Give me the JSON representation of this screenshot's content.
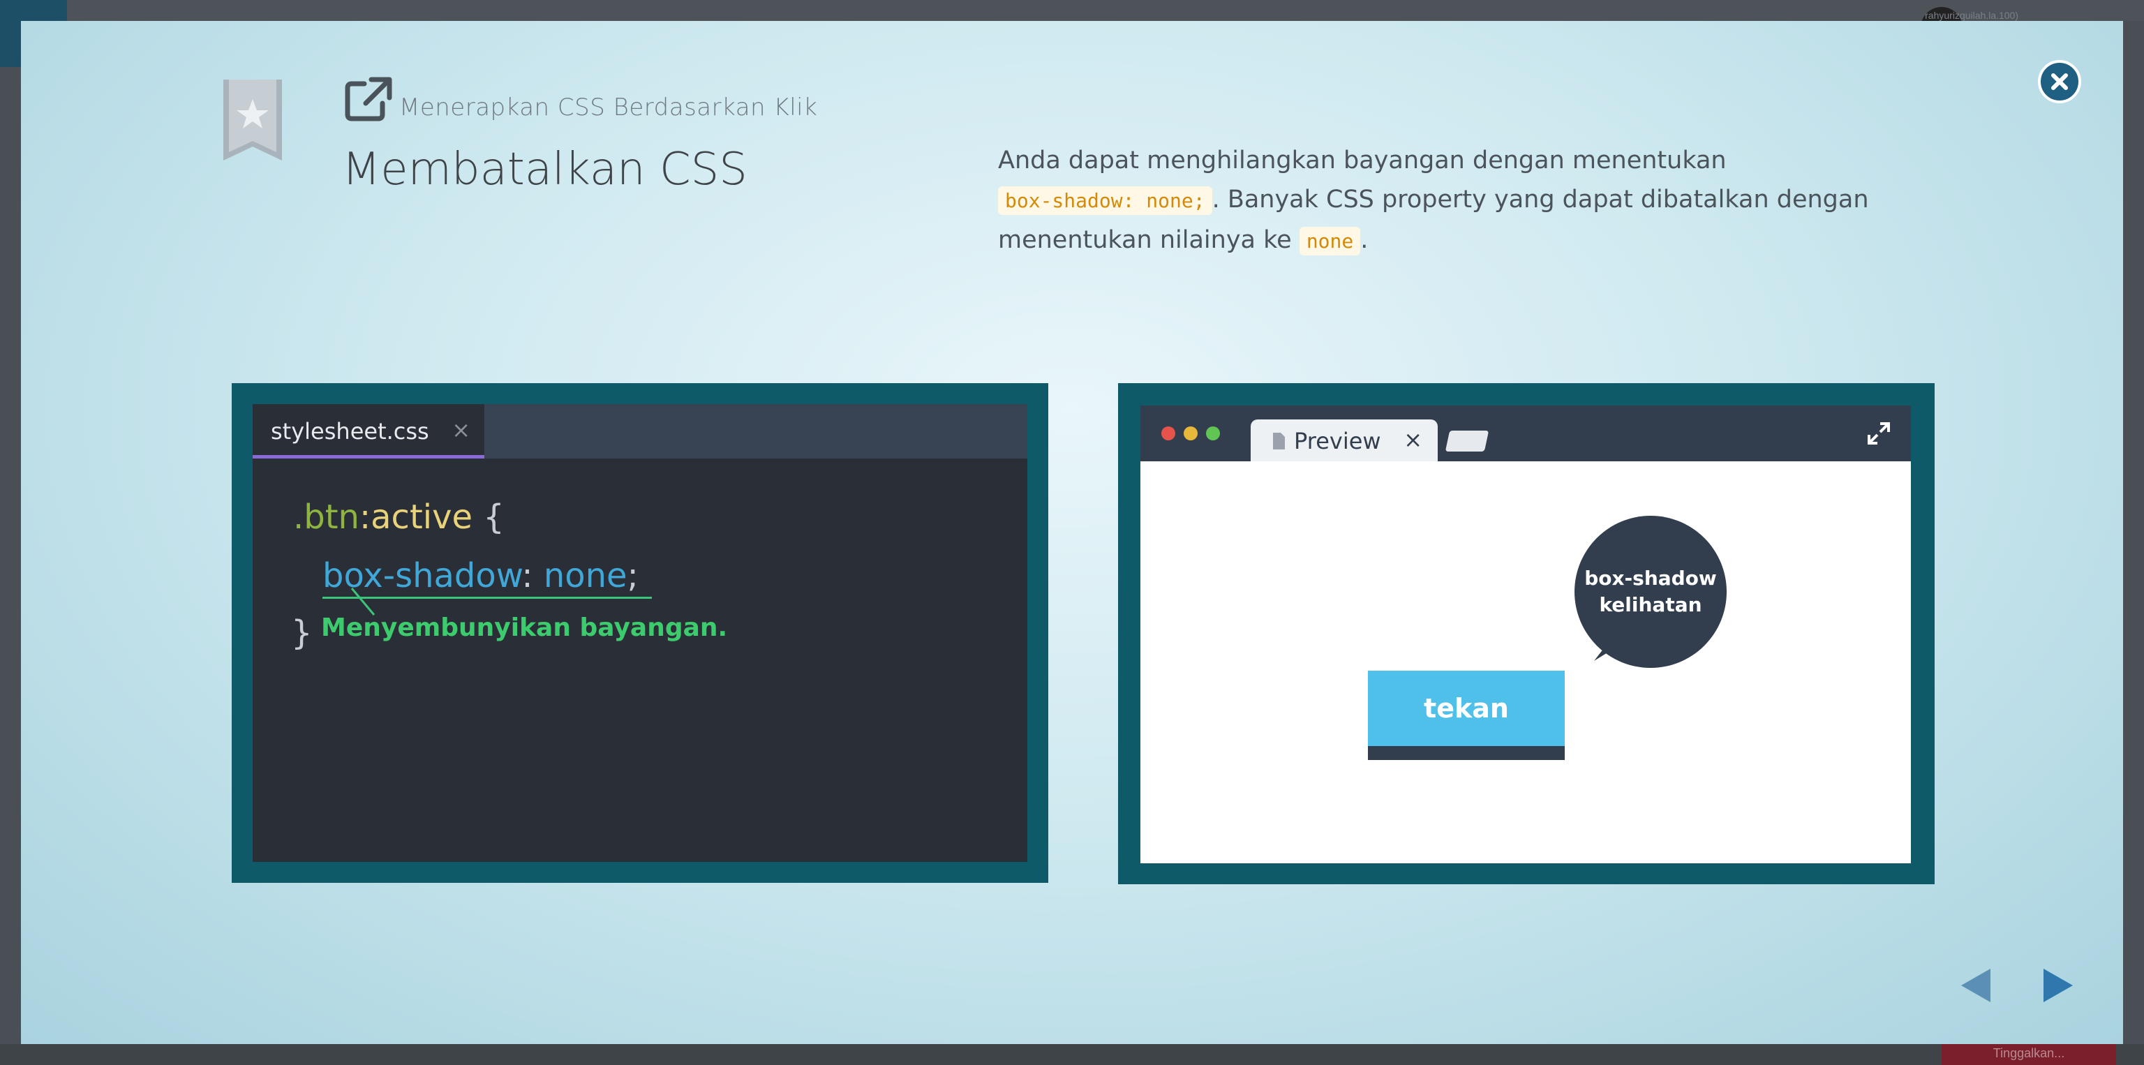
{
  "background": {
    "user_name": "rahyurizquilah.la.100)",
    "bottom_button": "Tinggalkan..."
  },
  "lesson": {
    "subtitle": "Menerapkan CSS Berdasarkan Klik",
    "title": "Membatalkan CSS",
    "description_part1": "Anda dapat menghilangkan bayangan dengan menentukan",
    "description_code1": "box-shadow: none;",
    "description_part2": ". Banyak CSS property yang dapat dibatalkan dengan menentukan nilainya ke",
    "description_code2": "none",
    "description_part3": "."
  },
  "editor": {
    "tab_name": "stylesheet.css",
    "tab_close": "×",
    "selector": ".btn",
    "pseudo": ":active",
    "open_brace": " {",
    "property": "box-shadow",
    "colon": ": ",
    "value": "none",
    "semicolon": ";",
    "close_brace": "}",
    "note": "Menyembunyikan bayangan."
  },
  "browser": {
    "tab_label": "Preview",
    "tab_close": "×",
    "bubble_line1": "box-shadow",
    "bubble_line2": "kelihatan",
    "button_label": "tekan"
  },
  "colors": {
    "close": "#1f5f82",
    "frame": "#0e5a68",
    "accent_button": "#4ec0ea",
    "note_green": "#3dcc6d"
  },
  "icons": [
    "bookmark-star-icon",
    "external-link-icon",
    "close-icon",
    "file-icon",
    "expand-icon",
    "prev-arrow-icon",
    "next-arrow-icon"
  ]
}
